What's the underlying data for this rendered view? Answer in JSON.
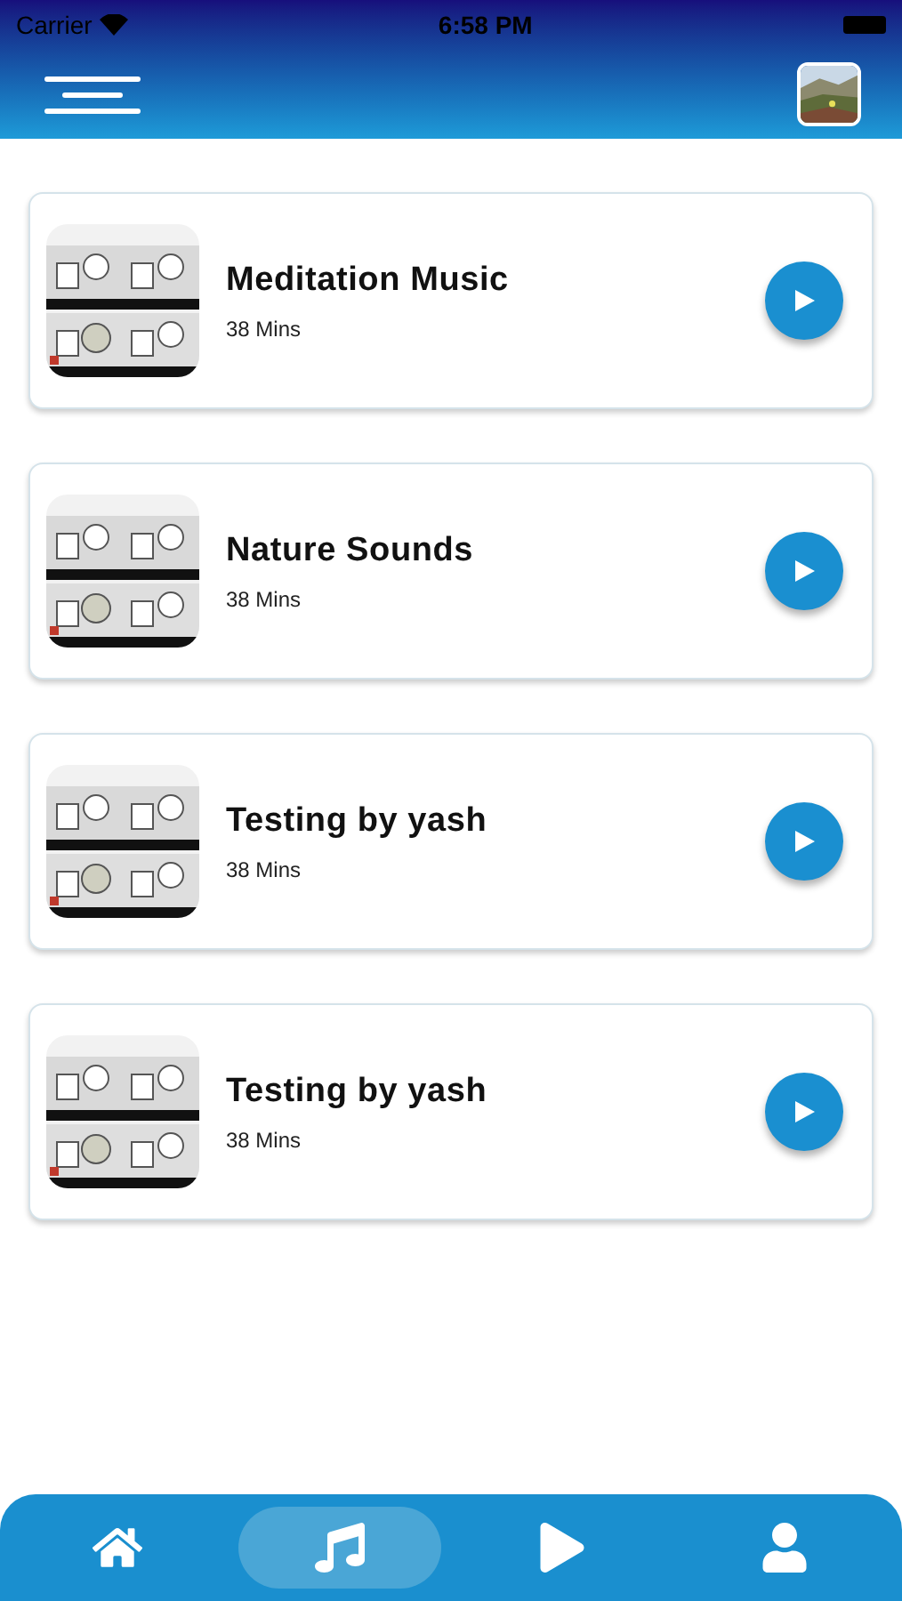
{
  "status_bar": {
    "carrier": "Carrier",
    "time": "6:58 PM"
  },
  "tracks": [
    {
      "title": "Meditation Music",
      "duration": "38 Mins"
    },
    {
      "title": "Nature Sounds",
      "duration": "38 Mins"
    },
    {
      "title": "Testing by yash",
      "duration": "38 Mins"
    },
    {
      "title": "Testing by yash",
      "duration": "38 Mins"
    }
  ],
  "bottom_nav": [
    {
      "selected": false
    },
    {
      "selected": true
    },
    {
      "selected": false
    },
    {
      "selected": false
    }
  ]
}
